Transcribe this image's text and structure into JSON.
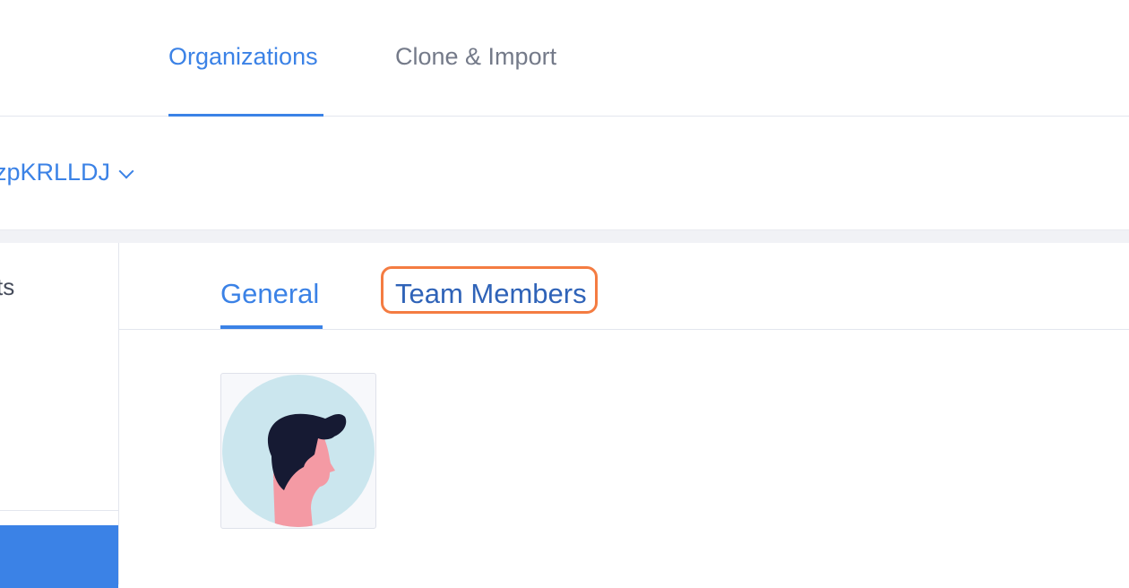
{
  "top_nav": {
    "tabs": [
      {
        "label": "Organizations",
        "active": true
      },
      {
        "label": "Clone & Import",
        "active": false
      }
    ]
  },
  "org_selector": {
    "name": "zpKRLLDJ",
    "icon": "chevron-down-icon"
  },
  "sidebar": {
    "items": [
      {
        "label": "ts"
      }
    ]
  },
  "sub_tabs": {
    "tabs": [
      {
        "label": "General",
        "active": true
      },
      {
        "label": "Team Members",
        "active": false,
        "highlighted": true
      }
    ]
  },
  "avatar": {
    "icon": "person-avatar-icon"
  },
  "colors": {
    "accent": "#3b82e6",
    "highlight": "#f47c42",
    "muted_text": "#747a89",
    "avatar_bg": "#cbe6ee",
    "hair": "#161a33",
    "skin": "#f49aa4"
  }
}
